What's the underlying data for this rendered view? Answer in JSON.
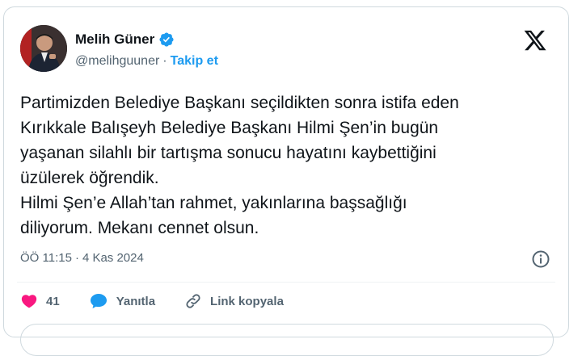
{
  "user": {
    "display_name": "Melih Güner",
    "handle": "@melihguuner",
    "separator": "·",
    "follow_label": "Takip et"
  },
  "tweet": {
    "text": "Partimizden Belediye Başkanı seçildikten sonra istifa eden\nKırıkkale Balışeyh Belediye Başkanı Hilmi Şen’in bugün\nyaşanan silahlı bir tartışma sonucu hayatını kaybettiğini\nüzülerek öğrendik.\nHilmi Şen’e Allah’tan rahmet, yakınlarına başsağlığı\ndiliyorum. Mekanı cennet olsun.",
    "time": "ÖÖ 11:15",
    "date_separator": "·",
    "date": "4 Kas 2024"
  },
  "actions": {
    "like_count": "41",
    "reply_label": "Yanıtla",
    "copy_link_label": "Link kopyala"
  },
  "icons": {
    "verified": "verified-badge-icon",
    "x_logo": "x-logo-icon",
    "info": "info-icon",
    "like": "heart-icon",
    "reply": "speech-bubble-icon",
    "link": "link-icon"
  },
  "colors": {
    "accent": "#1d9bf0",
    "like": "#f91880",
    "text": "#0f1419",
    "secondary": "#536471"
  }
}
